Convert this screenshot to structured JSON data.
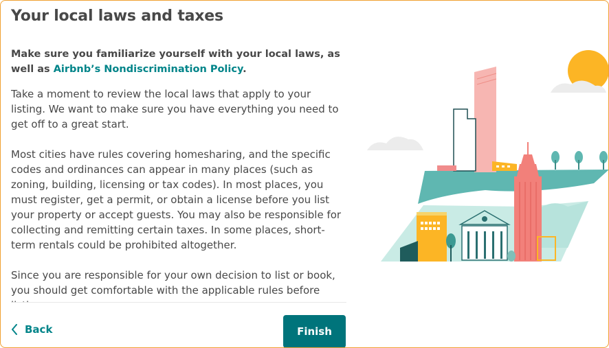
{
  "header": {
    "title": "Your local laws and taxes"
  },
  "intro": {
    "text_before_link": "Make sure you familiarize yourself with your local laws, as well as ",
    "link_text": "Airbnb’s Nondiscrimination Policy",
    "text_after_link": "."
  },
  "content": {
    "paragraphs": [
      "Take a moment to review the local laws that apply to your listing. We want to make sure you have everything you need to get off to a great start.",
      "Most cities have rules covering homesharing, and the specific codes and ordinances can appear in many places (such as zoning, building, licensing or tax codes). In most places, you must register, get a permit, or obtain a license before you list your property or accept guests. You may also be responsible for collecting and remitting certain taxes. In some places, short-term rentals could be prohibited altogether.",
      "Since you are responsible for your own decision to list or book, you should get comfortable with the applicable rules before listing on"
    ]
  },
  "footer": {
    "back_label": "Back",
    "finish_label": "Finish"
  },
  "colors": {
    "accent": "#008489",
    "button": "#00747b",
    "frame_border": "#f0a030",
    "text": "#484848"
  },
  "icons": {
    "back": "chevron-left-icon",
    "illustration": "city-illustration"
  }
}
